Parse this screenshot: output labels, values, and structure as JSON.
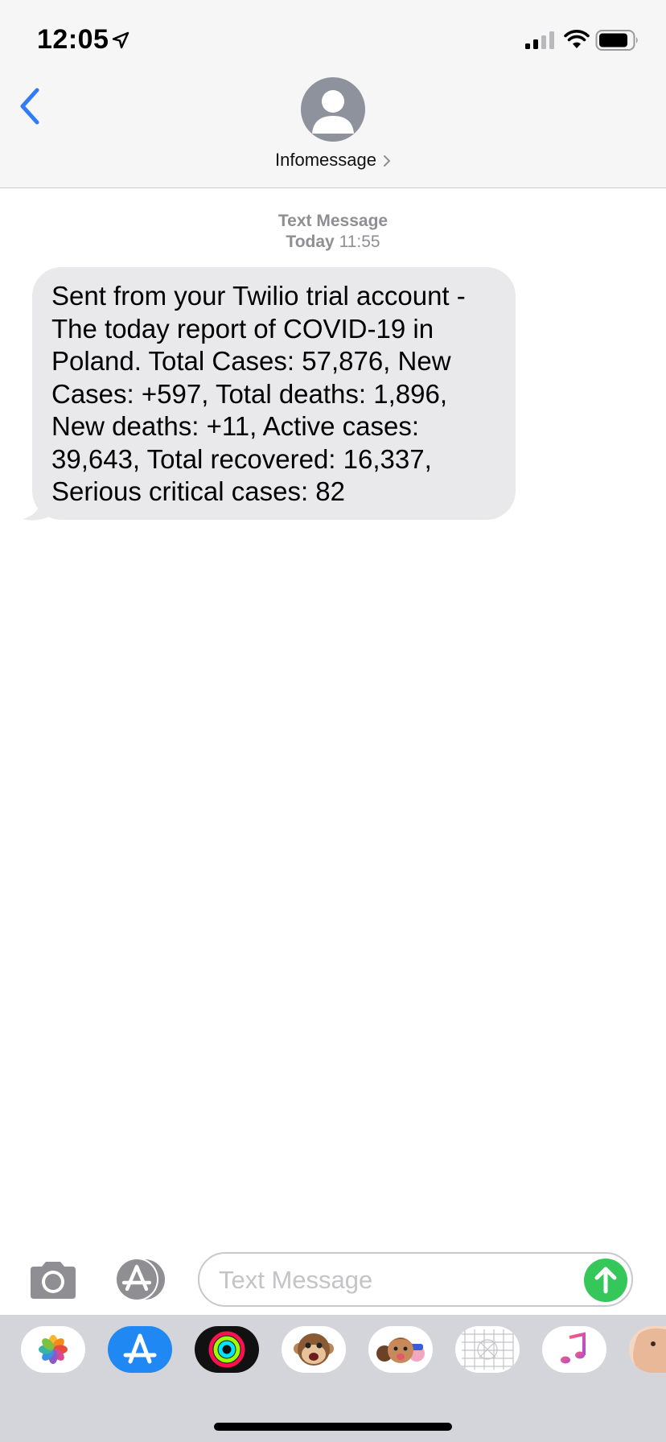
{
  "status_bar": {
    "time": "12:05",
    "location_icon": "location-arrow-icon",
    "signal_icon": "cellular-signal-icon",
    "wifi_icon": "wifi-icon",
    "battery_icon": "battery-icon"
  },
  "header": {
    "back_icon": "chevron-left-icon",
    "contact_name": "Infomessage",
    "avatar_icon": "person-icon"
  },
  "conversation": {
    "meta_label": "Text Message",
    "meta_day": "Today",
    "meta_time": "11:55",
    "messages": [
      {
        "direction": "incoming",
        "text": "Sent from your Twilio trial account - The today report of COVID-19 in Poland. Total Cases: 57,876, New Cases: +597, Total deaths: 1,896, New deaths: +11, Active cases: 39,643, Total recovered: 16,337, Serious critical cases: 82"
      }
    ]
  },
  "composer": {
    "camera_icon": "camera-icon",
    "apps_icon": "app-store-icon",
    "placeholder": "Text Message",
    "value": "",
    "send_icon": "send-arrow-icon"
  },
  "app_drawer": {
    "apps": [
      "photos-icon",
      "app-store-icon",
      "activity-icon",
      "animoji-icon",
      "memoji-icon",
      "digital-touch-icon",
      "music-icon",
      "sticker-icon"
    ]
  },
  "colors": {
    "ios_blue": "#2f7cf6",
    "bubble_gray": "#e9e9eb",
    "send_green": "#35c759",
    "meta_gray": "#8e8e93"
  }
}
